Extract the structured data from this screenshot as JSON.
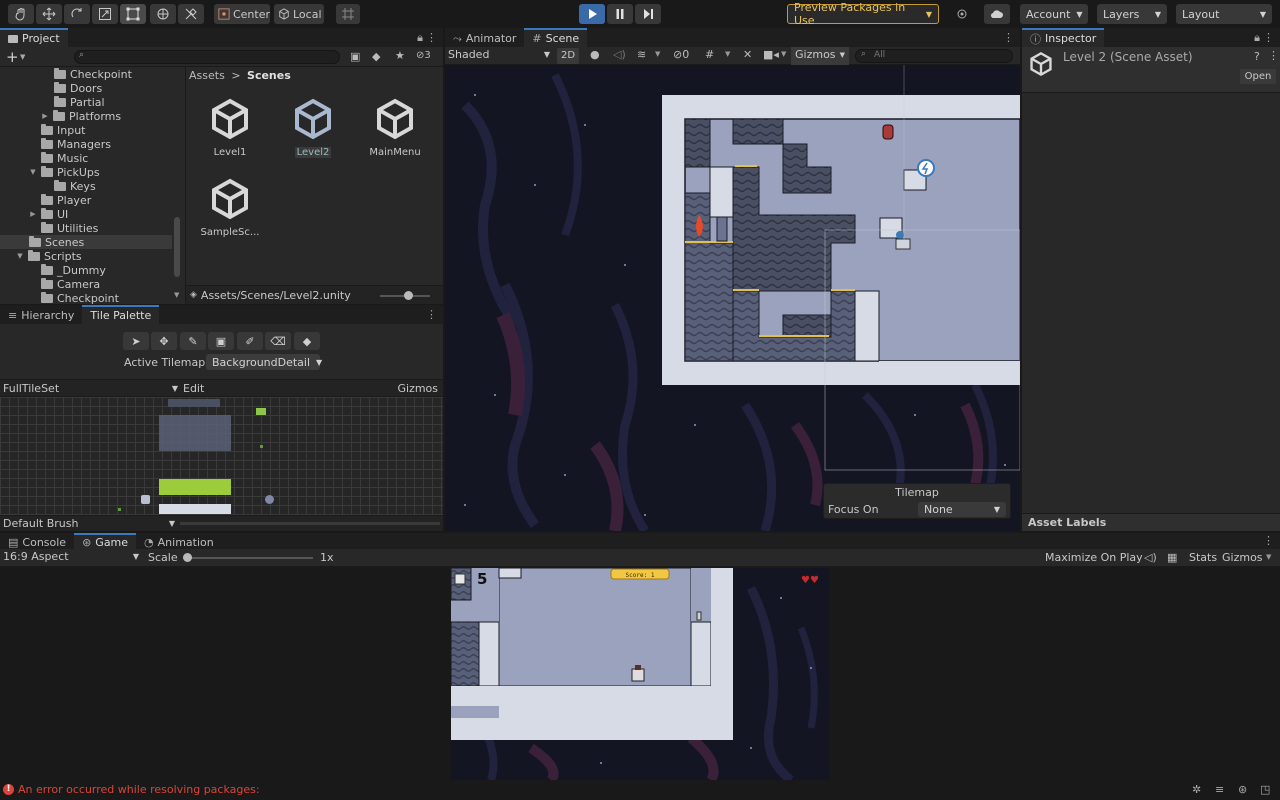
{
  "toolbar": {
    "pivot_label": "Center",
    "space_label": "Local",
    "preview_packages": "Preview Packages in Use",
    "account": "Account",
    "layers": "Layers",
    "layout": "Layout"
  },
  "project": {
    "tab": "Project",
    "hidden_count": "3",
    "tree": [
      "Checkpoint",
      "Doors",
      "Partial",
      "Platforms",
      "Input",
      "Managers",
      "Music",
      "PickUps",
      "Keys",
      "Player",
      "UI",
      "Utilities",
      "Scenes",
      "Scripts",
      "_Dummy",
      "Camera",
      "Checkpoint"
    ],
    "breadcrumb_root": "Assets",
    "breadcrumb_current": "Scenes",
    "assets": [
      "Level1",
      "Level2",
      "MainMenu",
      "SampleSc..."
    ],
    "path": "Assets/Scenes/Level2.unity"
  },
  "palette": {
    "tab_hierarchy": "Hierarchy",
    "tab_tile_palette": "Tile Palette",
    "active_tilemap_label": "Active Tilemap",
    "active_tilemap_value": "BackgroundDetail",
    "palette_name": "FullTileSet",
    "edit_label": "Edit",
    "gizmos_label": "Gizmos",
    "brush": "Default Brush"
  },
  "scene": {
    "tab_animator": "Animator",
    "tab_scene": "Scene",
    "shading": "Shaded",
    "mode_2d": "2D",
    "hidden_count": "0",
    "gizmos": "Gizmos",
    "search_placeholder": "All",
    "overlay_title": "Tilemap",
    "focus_label": "Focus On",
    "focus_value": "None"
  },
  "inspector": {
    "tab": "Inspector",
    "title": "Level 2 (Scene Asset)",
    "open_label": "Open",
    "asset_labels": "Asset Labels"
  },
  "bottom": {
    "tab_console": "Console",
    "tab_game": "Game",
    "tab_animation": "Animation",
    "aspect": "16:9 Aspect",
    "scale_label": "Scale",
    "scale_value": "1x",
    "maximize": "Maximize On Play",
    "stats": "Stats",
    "gizmos": "Gizmos",
    "hud_count": "5",
    "hud_score": "Score: 1"
  },
  "status": {
    "error": "An error occurred while resolving packages:"
  },
  "colors": {
    "accent": "#3a79bb",
    "play_active": "#3a6aa8",
    "preview_border": "#c79a2c",
    "error": "#d9453a"
  }
}
